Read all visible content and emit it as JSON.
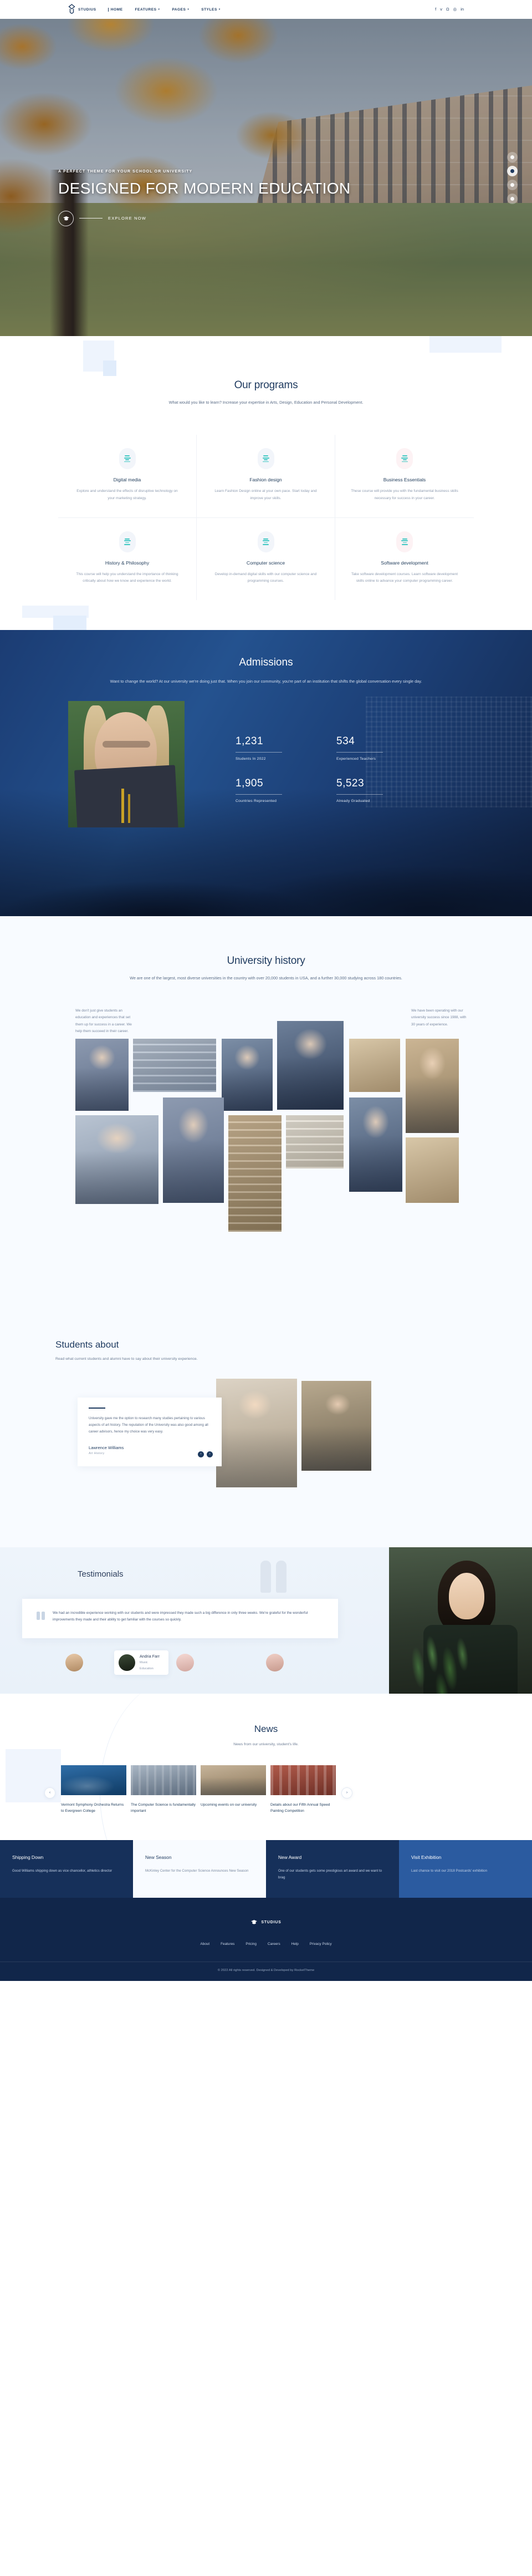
{
  "nav": {
    "brand": "STUDIUS",
    "brand_icon": "graduation-diamond-logo-icon",
    "links": [
      {
        "label": "HOME",
        "caret": "",
        "active": true
      },
      {
        "label": "FEATURES",
        "caret": "▾",
        "active": false
      },
      {
        "label": "PAGES",
        "caret": "▾",
        "active": false
      },
      {
        "label": "STYLES",
        "caret": "▾",
        "active": false
      }
    ],
    "social": [
      {
        "icon": "facebook-icon",
        "glyph": "f"
      },
      {
        "icon": "twitter-icon",
        "glyph": "ᴠ"
      },
      {
        "icon": "headphones-icon",
        "glyph": "Ω"
      },
      {
        "icon": "instagram-icon",
        "glyph": "◎"
      },
      {
        "icon": "linkedin-icon",
        "glyph": "in"
      }
    ]
  },
  "hero": {
    "kicker": "A PERFECT THEME FOR YOUR SCHOOL OR UNIVERSITY",
    "title": "DESIGNED FOR MODERN EDUCATION",
    "cta_label": "EXPLORE NOW",
    "cta_icon": "graduation-cap-icon",
    "slide_dots": [
      {
        "icon": "slide-dot-1-icon",
        "active": false
      },
      {
        "icon": "slide-dot-2-icon",
        "active": true
      },
      {
        "icon": "slide-dot-3-icon",
        "active": false
      },
      {
        "icon": "slide-dot-4-icon",
        "active": false
      }
    ]
  },
  "programs": {
    "title": "Our programs",
    "subtitle": "What would you like to learn? Increase your expertise in Arts, Design, Education and Personal Development.",
    "cards": [
      {
        "name": "Digital media",
        "desc": "Explore and understand the effects of disruptive technology on your marketing strategy.",
        "icon": "bars-icon"
      },
      {
        "name": "Fashion design",
        "desc": "Learn Fashion Design online at your own pace. Start today and improve your skills.",
        "icon": "bars-icon"
      },
      {
        "name": "Business Essentials",
        "desc": "These course will provide you with the fundamental business skills necessary for success in your career.",
        "icon": "bars-icon"
      },
      {
        "name": "History & Philosophy",
        "desc": "This course will help you understand the importance of thinking critically about how we know and experience the world.",
        "icon": "bars-icon"
      },
      {
        "name": "Computer science",
        "desc": "Develop in-demand digital skills with our computer science and programming courses.",
        "icon": "bars-icon"
      },
      {
        "name": "Software development",
        "desc": "Take software development courses. Learn software development skills online to advance your computer programming career.",
        "icon": "bars-icon"
      }
    ]
  },
  "admissions": {
    "title": "Admissions",
    "lead": "Want to change the world? At our university we're doing just that. When you join our community, you're part of an institution that shifts the global conversation every single day.",
    "stats": [
      {
        "number": "1,231",
        "label": "Students In 2022"
      },
      {
        "number": "534",
        "label": "Experienced Teachers"
      },
      {
        "number": "1,905",
        "label": "Countries Represented"
      },
      {
        "number": "5,523",
        "label": "Already Graduated"
      }
    ]
  },
  "history": {
    "title": "University history",
    "subtitle": "We are one of the largest, most diverse universities in the country with over 20,000 students in USA, and a further 30,000 studying across 180 countries.",
    "note_left": "We don't just give students an education and experiences that set them up for success in a career. We help them succeed in their career.",
    "note_right": "We have been operating with our university success since 1988, with 30 years of experience."
  },
  "students_about": {
    "title": "Students about",
    "subtitle": "Read what current students and alumni have to say about their university experience.",
    "quote": "University gave me the option to research many studies pertaining to various aspects of art history. The reputation of the University was also good among all career advisors, hence my choice was very easy.",
    "author": "Lawrence Williams",
    "role": "Art History",
    "prev_icon": "chevron-left-icon",
    "next_icon": "chevron-right-icon",
    "prev_glyph": "‹",
    "next_glyph": "›"
  },
  "testimonials": {
    "title": "Testimonials",
    "quote_icon": "quote-mark-icon",
    "quote": "We had an incredible experience working with our students and were impressed they made such a big difference in only three weeks. We're grateful for the wonderful improvements they made and their ability to get familiar with the courses so quickly.",
    "active_author": {
      "name": "Andria Farr",
      "role_line1": "Music",
      "role_line2": "Education"
    },
    "avatars": [
      {
        "icon": "avatar-1-icon"
      },
      {
        "icon": "avatar-2-icon"
      },
      {
        "icon": "avatar-3-icon"
      },
      {
        "icon": "avatar-4-icon"
      }
    ]
  },
  "news": {
    "title": "News",
    "subtitle": "News from our university, student's life.",
    "prev_glyph": "‹",
    "next_glyph": "›",
    "prev_icon": "chevron-left-icon",
    "next_icon": "chevron-right-icon",
    "items": [
      {
        "title": "Vermont Symphony Orchestra Returns to Evergreen College",
        "image": "news-image-orchestra"
      },
      {
        "title": "The Computer Science is fundamentally important",
        "image": "news-image-campus"
      },
      {
        "title": "Upcoming events on our university",
        "image": "news-image-events"
      },
      {
        "title": "Details about our Fifth Annual Speed Painting Competition",
        "image": "news-image-painting"
      }
    ]
  },
  "strip": [
    {
      "title": "Shipping Down",
      "desc": "Good Williams shipping down as vice chancellor, athletics director"
    },
    {
      "title": "New Season",
      "desc": "McKinley Center for the Computer Science Announces New Season"
    },
    {
      "title": "New Award",
      "desc": "One of our students gets some prestigious art award and we want to brag"
    },
    {
      "title": "Visit Exhibition",
      "desc": "Last chance to visit our 2018 Postcards' exhibition"
    }
  ],
  "footer": {
    "brand": "STUDIUS",
    "brand_icon": "graduation-cap-icon",
    "links": [
      "About",
      "Features",
      "Pricing",
      "Careers",
      "Help",
      "Privacy Policy"
    ],
    "copyright": "© 2022 All rights reserved. Designed & Developed by RocketTheme"
  }
}
